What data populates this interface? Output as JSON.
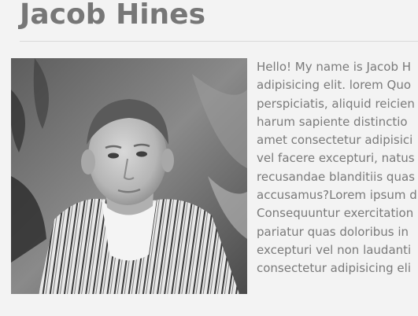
{
  "profile": {
    "name": "Jacob Hines",
    "photo_icon": "portrait-photo",
    "bio_lines": [
      "Hello! My name is Jacob H",
      "adipisicing elit. lorem Quo",
      "perspiciatis, aliquid reicien",
      "harum sapiente distinctio",
      "amet consectetur adipisici",
      "vel facere excepturi, natus",
      "recusandae blanditiis quas",
      "accusamus?Lorem ipsum d",
      "Consequuntur exercitation",
      "pariatur quas doloribus in",
      "excepturi vel non laudanti",
      "consectetur adipisicing eli"
    ]
  },
  "colors": {
    "background": "#f3f3f3",
    "title": "#777777",
    "text": "#7a7a7a",
    "rule": "#d9d9d9"
  }
}
